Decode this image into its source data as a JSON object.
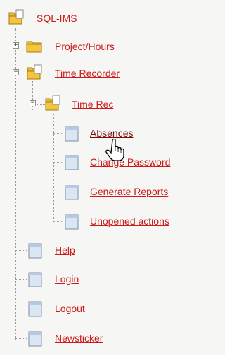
{
  "tree": {
    "root": {
      "label": "SQL-IMS",
      "icon": "folder-open-icon"
    },
    "project_hours": {
      "label": "Project/Hours",
      "icon": "folder-closed-icon",
      "toggle": "+"
    },
    "time_recorder": {
      "label": "Time Recorder",
      "icon": "folder-open-icon",
      "toggle": "−"
    },
    "time_rec": {
      "label": "Time Rec",
      "icon": "folder-open-icon",
      "toggle": "−"
    },
    "time_rec_children": [
      {
        "label": "Absences",
        "icon": "page-icon"
      },
      {
        "label": "Change Password",
        "icon": "page-icon"
      },
      {
        "label": "Generate Reports",
        "icon": "page-icon"
      },
      {
        "label": "Unopened actions",
        "icon": "page-icon"
      }
    ],
    "root_pages": [
      {
        "label": "Help",
        "icon": "page-icon"
      },
      {
        "label": "Login",
        "icon": "page-icon"
      },
      {
        "label": "Logout",
        "icon": "page-icon"
      },
      {
        "label": "Newsticker",
        "icon": "page-icon"
      }
    ]
  },
  "colors": {
    "link": "#cc1b1b",
    "folder": "#f5c542",
    "page": "#dbe6f5",
    "background": "#f6f6f4"
  }
}
